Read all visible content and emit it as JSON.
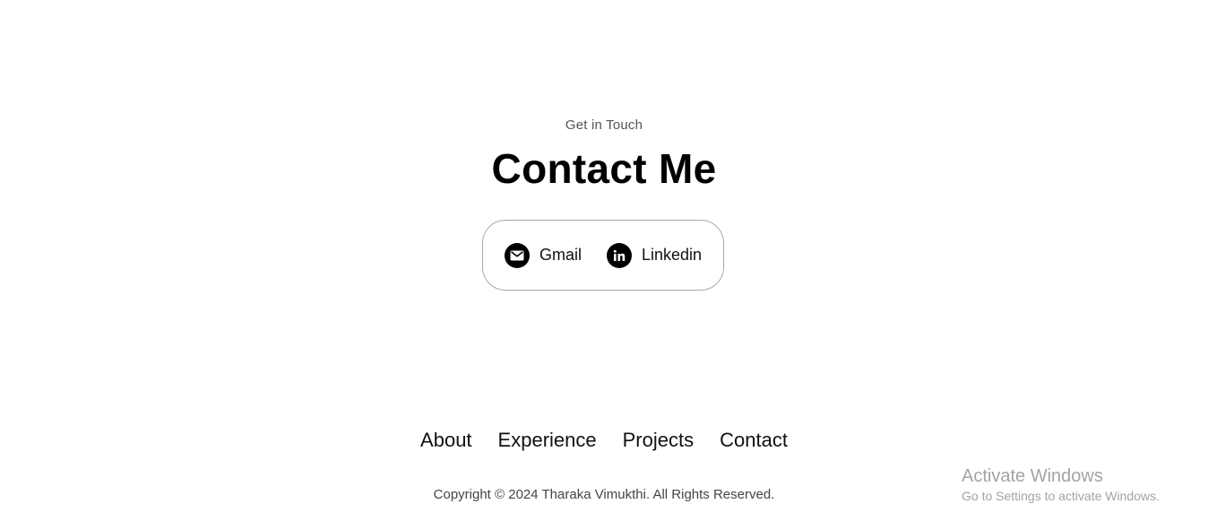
{
  "contact": {
    "eyebrow": "Get in Touch",
    "title": "Contact Me",
    "links": [
      {
        "label": "Gmail",
        "icon": "mail-icon"
      },
      {
        "label": "Linkedin",
        "icon": "linkedin-icon"
      }
    ]
  },
  "footer": {
    "nav": [
      "About",
      "Experience",
      "Projects",
      "Contact"
    ],
    "copyright": "Copyright © 2024 Tharaka Vimukthi. All Rights Reserved."
  },
  "watermark": {
    "title": "Activate Windows",
    "subtitle": "Go to Settings to activate Windows."
  },
  "colors": {
    "background": "#ffffff",
    "text": "#111111",
    "muted": "#555555",
    "border": "#a8a8a8",
    "watermark": "#a3a3a3"
  }
}
